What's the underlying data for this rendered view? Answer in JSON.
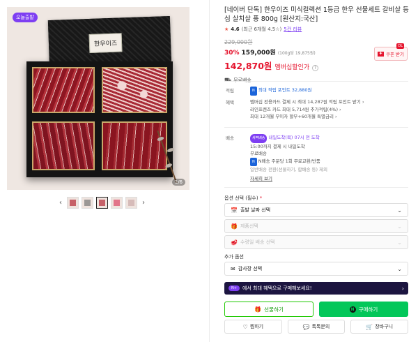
{
  "gallery": {
    "badge": "오늘출발",
    "box_label": "한우이즈",
    "counter": "1/6",
    "thumbnails": [
      "thumb-1",
      "thumb-2",
      "thumb-3",
      "thumb-4",
      "thumb-5"
    ],
    "active_thumb": 3
  },
  "product": {
    "title": "[네이버 단독] 한우이즈 미식컬렉션 1등급 한우 선물세트 갈비살 등심 살치살 풍 800g [원산지:국산]",
    "rating": "4.6",
    "rating_note": "(최근 6개월 4.5☆)",
    "reviews": "5건 리뷰",
    "original_price": "229,000원",
    "discount": "30%",
    "price": "159,000원",
    "unit_price": "(100g당 19,875원)",
    "member_price": "142,870원",
    "member_label": "멤버십할인가",
    "shipping": "무료배송"
  },
  "coupon": {
    "dl": "DL",
    "label": "쿠폰 받기"
  },
  "benefits": {
    "points_label": "적립",
    "points_text": "최대 적립 포인트 32,880원",
    "benefit_label": "혜택",
    "lines": [
      "멤버십 전용카드 결제 시 최대 14,287원 적립 포인트 받기",
      "라인프렌즈 카드 최대 5,714원 추가적립(4%)",
      "최대 12개월 무이자 할부+60개월 특별금리"
    ]
  },
  "delivery": {
    "label": "배송",
    "arrival_badge": "새벽배송",
    "arrival_text": "내일도착(목) 07시 전 도착",
    "line2": "15:00까지 결제 시 내일도착",
    "line3": "무료배송",
    "return_badge": "N배송",
    "return_text": "N배송 주문당 1회 무료교환/반품",
    "line5": "일반배송 전환(선물하기, 합배송 등) 제외",
    "more": "자세히 보기"
  },
  "options": {
    "title": "옵션 선택 (필수)",
    "required_mark": "*",
    "select1": "출발 날짜 선택",
    "select2": "제품선택",
    "select3": "수령일 배송 선택",
    "extra_title": "추가 옵션",
    "select4": "감사장 선택"
  },
  "promo": {
    "badge": "N+",
    "text": "에서 최대 혜택으로 구매해보세요!"
  },
  "actions": {
    "gift": "선물하기",
    "buy": "구매하기",
    "like": "찜하기",
    "talk": "톡톡문의",
    "cart": "장바구니"
  }
}
